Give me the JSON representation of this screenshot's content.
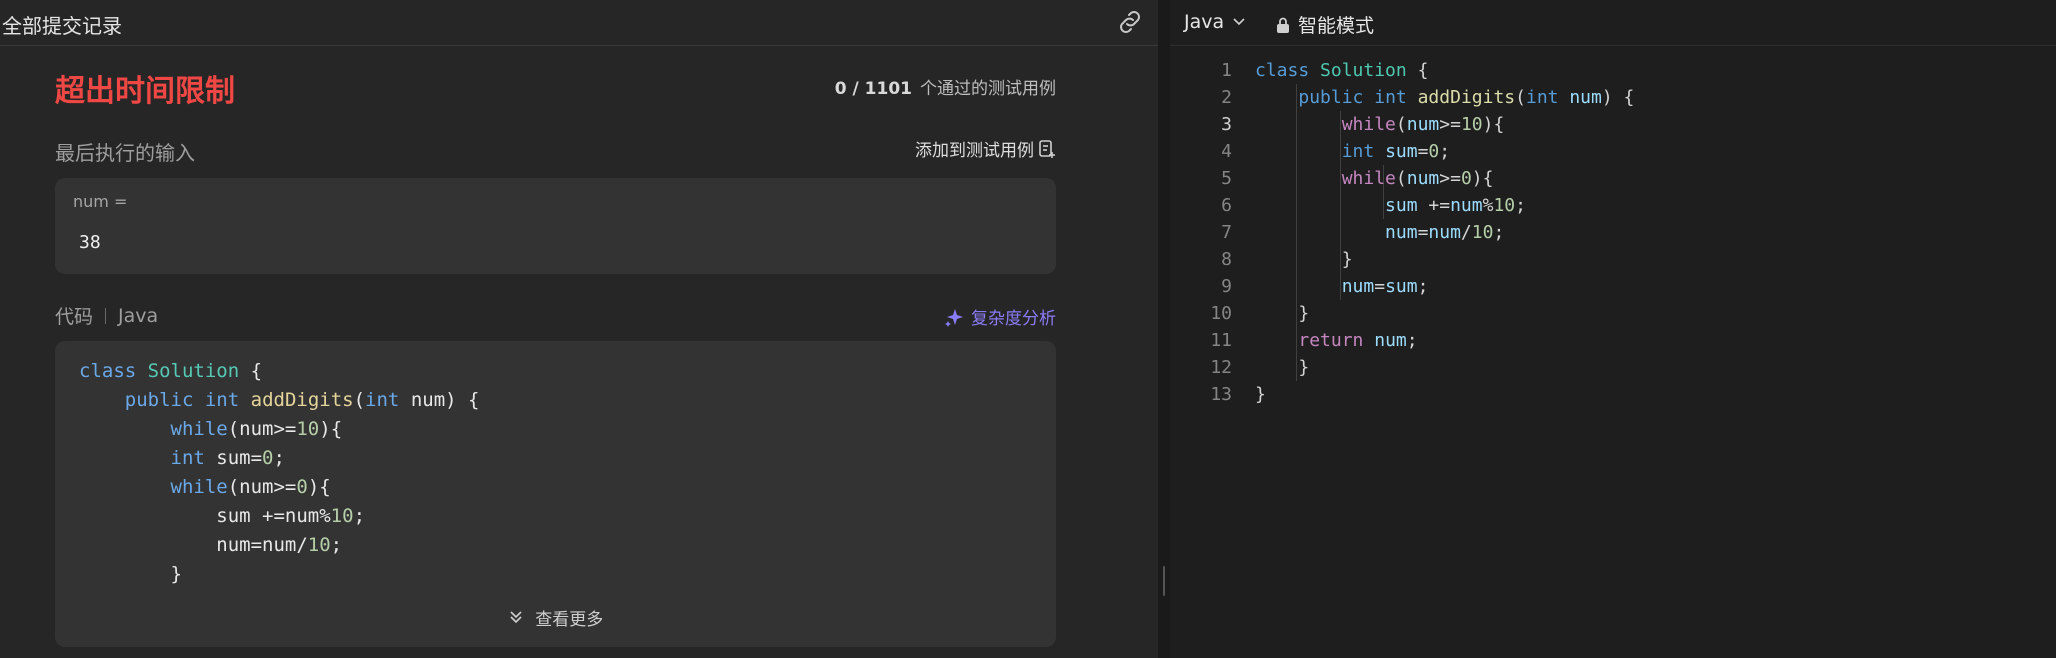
{
  "left_panel": {
    "header_title": "全部提交记录",
    "status": "超出时间限制",
    "passed": "0 / 1101",
    "passed_suffix": "个通过的测试用例",
    "last_input_label": "最后执行的输入",
    "add_testcase_label": "添加到测试用例",
    "input_name": "num =",
    "input_value": "38",
    "code_label": "代码",
    "code_lang": "Java",
    "complexity_label": "复杂度分析",
    "see_more_label": "查看更多",
    "code_preview_lines": [
      "class Solution {",
      "    public int addDigits(int num) {",
      "        while(num>=10){",
      "        int sum=0;",
      "        while(num>=0){",
      "            sum +=num%10;",
      "            num=num/10;",
      "        }"
    ]
  },
  "right_panel": {
    "language": "Java",
    "mode_label": "智能模式",
    "active_line": 3,
    "line_numbers": [
      "1",
      "2",
      "3",
      "4",
      "5",
      "6",
      "7",
      "8",
      "9",
      "10",
      "11",
      "12",
      "13"
    ],
    "code_lines": [
      "class Solution {",
      "    public int addDigits(int num) {",
      "        while(num>=10){",
      "        int sum=0;",
      "        while(num>=0){",
      "            sum +=num%10;",
      "            num=num/10;",
      "        }",
      "        num=sum;",
      "    }",
      "    return num;",
      "    }",
      "}"
    ]
  },
  "icons": {
    "link": "link-icon",
    "add_testcase": "add-to-testcase-icon",
    "complexity": "sparkle-icon",
    "see_more": "double-chevron-down-icon",
    "lang_dropdown": "chevron-down-icon",
    "mode": "lock-icon"
  },
  "colors": {
    "status_error": "#ef4743",
    "accent_purple": "#8a7cf6"
  }
}
